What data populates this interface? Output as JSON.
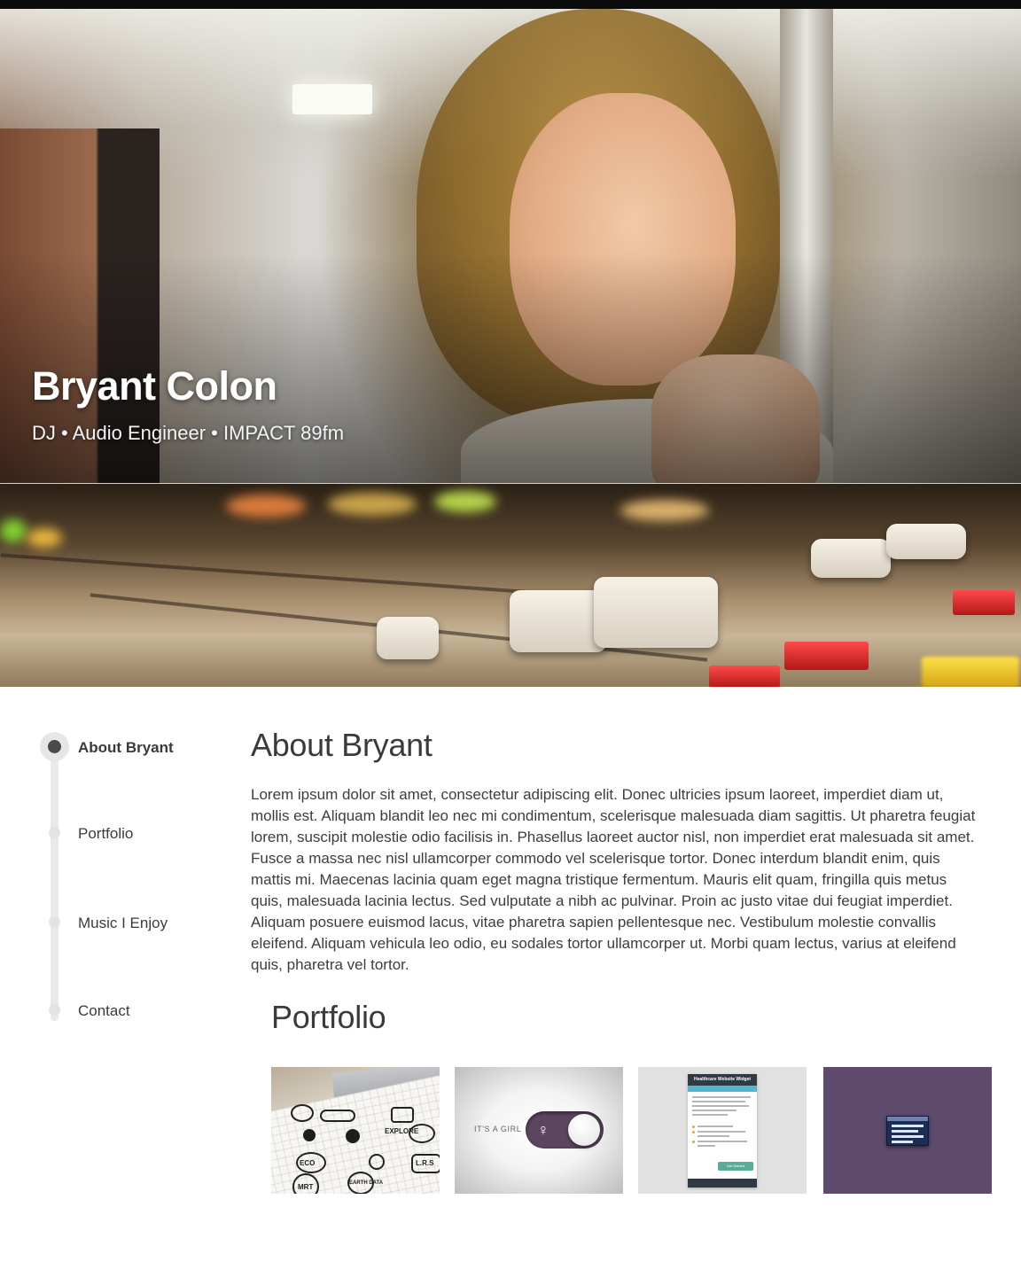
{
  "hero": {
    "name": "Bryant Colon",
    "tagline": "DJ • Audio Engineer • IMPACT 89fm"
  },
  "sidebar": {
    "items": [
      {
        "label": "About Bryant",
        "active": true
      },
      {
        "label": "Portfolio",
        "active": false
      },
      {
        "label": "Music I Enjoy",
        "active": false
      },
      {
        "label": "Contact",
        "active": false
      }
    ]
  },
  "about": {
    "title": "About Bryant",
    "body": "Lorem ipsum dolor sit amet, consectetur adipiscing elit. Donec ultricies ipsum laoreet, imperdiet diam ut, mollis est. Aliquam blandit leo nec mi condimentum, scelerisque malesuada diam sagittis. Ut pharetra feugiat lorem, suscipit molestie odio facilisis in. Phasellus laoreet auctor nisl, non imperdiet erat malesuada sit amet. Fusce a massa nec nisl ullamcorper commodo vel scelerisque tortor. Donec interdum blandit enim, quis mattis mi. Maecenas lacinia quam eget magna tristique fermentum. Mauris elit quam, fringilla quis metus quis, malesuada lacinia lectus. Sed vulputate a nibh ac pulvinar. Proin ac justo vitae dui feugiat imperdiet. Aliquam posuere euismod lacus, vitae pharetra sapien pellentesque nec. Vestibulum molestie convallis eleifend. Aliquam vehicula leo odio, eu sodales tortor ullamcorper ut. Morbi quam lectus, varius at eleifend quis, pharetra vel tortor."
  },
  "portfolio": {
    "title": "Portfolio",
    "thumbnails": [
      {
        "name": "sketches",
        "sketch_labels": [
          "EXPLORE",
          "ECO",
          "L.R.S",
          "MRT",
          "EARTH DATA"
        ]
      },
      {
        "name": "toggle",
        "label": "IT'S A GIRL",
        "icon": "person-icon",
        "accent": "#5c4560"
      },
      {
        "name": "widget",
        "header": "Healthcare Website Widget",
        "button": "Get Started"
      },
      {
        "name": "screen",
        "background": "#5d4a6c"
      }
    ]
  }
}
